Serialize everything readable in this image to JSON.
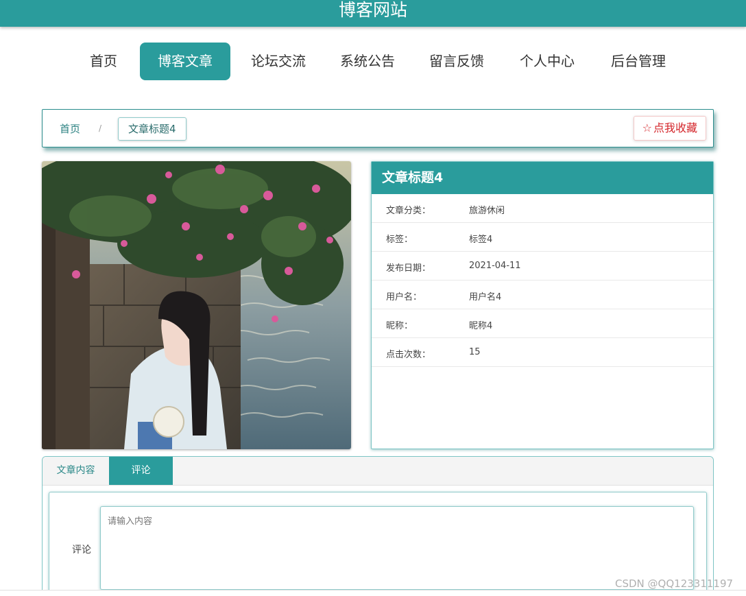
{
  "header": {
    "site_title": "博客网站"
  },
  "nav": {
    "items": [
      {
        "label": "首页"
      },
      {
        "label": "博客文章"
      },
      {
        "label": "论坛交流"
      },
      {
        "label": "系统公告"
      },
      {
        "label": "留言反馈"
      },
      {
        "label": "个人中心"
      },
      {
        "label": "后台管理"
      }
    ],
    "active_index": 1
  },
  "breadcrumb": {
    "home": "首页",
    "separator": "/",
    "current": "文章标题4",
    "favorite_label": "点我收藏"
  },
  "article": {
    "title": "文章标题4",
    "fields": [
      {
        "key": "文章分类：",
        "value": "旅游休闲"
      },
      {
        "key": "标签：",
        "value": "标签4"
      },
      {
        "key": "发布日期：",
        "value": "2021-04-11"
      },
      {
        "key": "用户名：",
        "value": "用户名4"
      },
      {
        "key": "昵称：",
        "value": "昵称4"
      },
      {
        "key": "点击次数：",
        "value": "15"
      }
    ]
  },
  "tabs": {
    "content_label": "文章内容",
    "comment_label": "评论"
  },
  "comment_form": {
    "label": "评论",
    "placeholder": "请输入内容"
  },
  "watermark": "CSDN @QQ123311197",
  "colors": {
    "accent": "#2a9c9c",
    "favorite": "#d4252a"
  }
}
